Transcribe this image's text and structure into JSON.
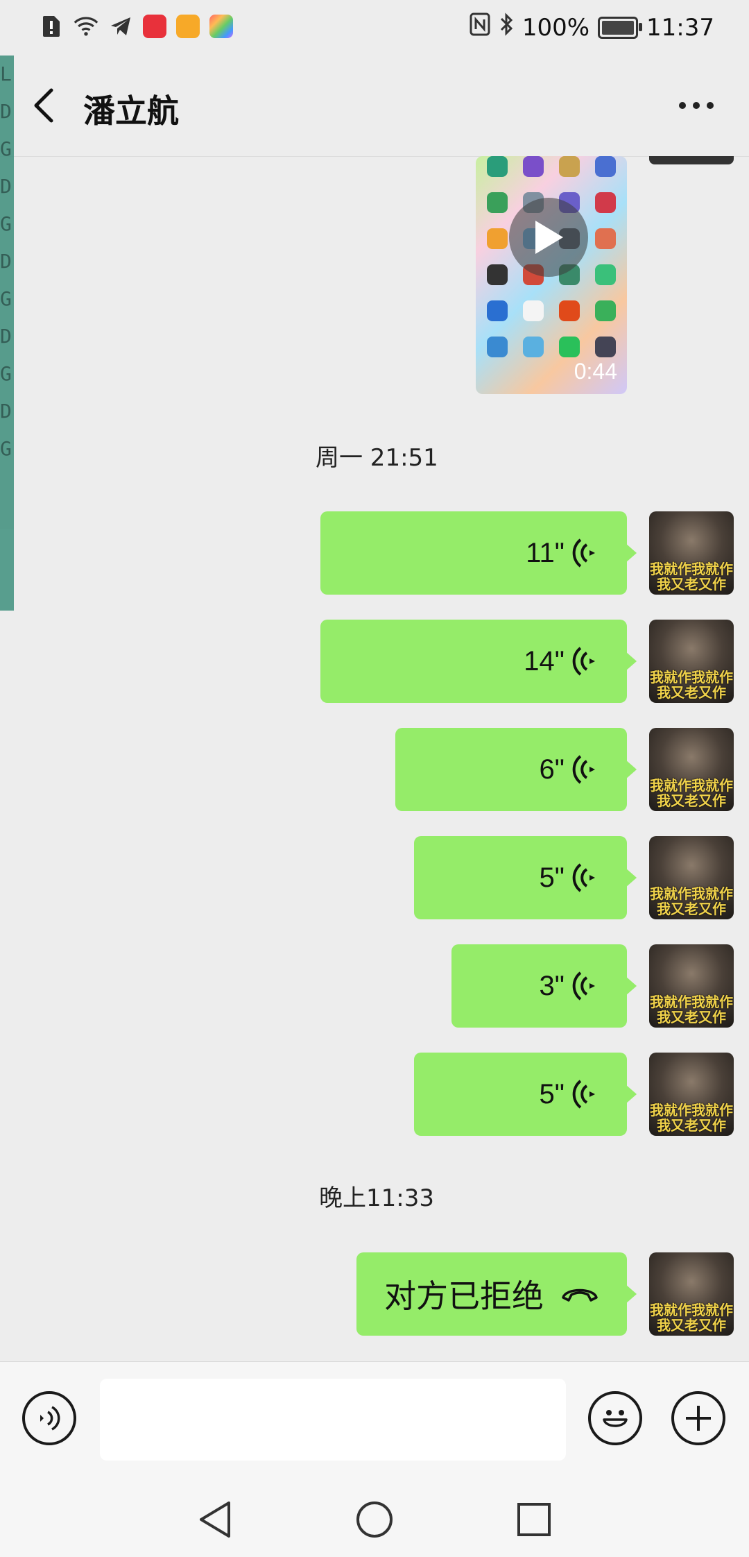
{
  "status_bar": {
    "battery_percent": "100%",
    "time": "11:37",
    "app_badges": [
      "huawei-appgallery-icon",
      "files-icon",
      "gallery-icon"
    ]
  },
  "header": {
    "title": "潘立航"
  },
  "debug_overlay": {
    "letters": [
      "L",
      "D",
      "G",
      "D",
      "G",
      "D",
      "G",
      "D",
      "G",
      "D",
      "G"
    ]
  },
  "chat": {
    "video_message": {
      "duration": "0:44"
    },
    "timestamps": [
      "周一 21:51",
      "晚上11:33"
    ],
    "voice_messages": [
      {
        "duration": "11\""
      },
      {
        "duration": "14\""
      },
      {
        "duration": "6\""
      },
      {
        "duration": "5\""
      },
      {
        "duration": "3\""
      },
      {
        "duration": "5\""
      }
    ],
    "call_message": {
      "text": "对方已拒绝"
    },
    "avatar_caption_line1": "我就作我就作",
    "avatar_caption_line2": "我又老又作"
  },
  "input": {
    "text_value": ""
  },
  "colors": {
    "bubble": "#95ec69",
    "background": "#ededed",
    "input_bar": "#f6f6f6"
  }
}
